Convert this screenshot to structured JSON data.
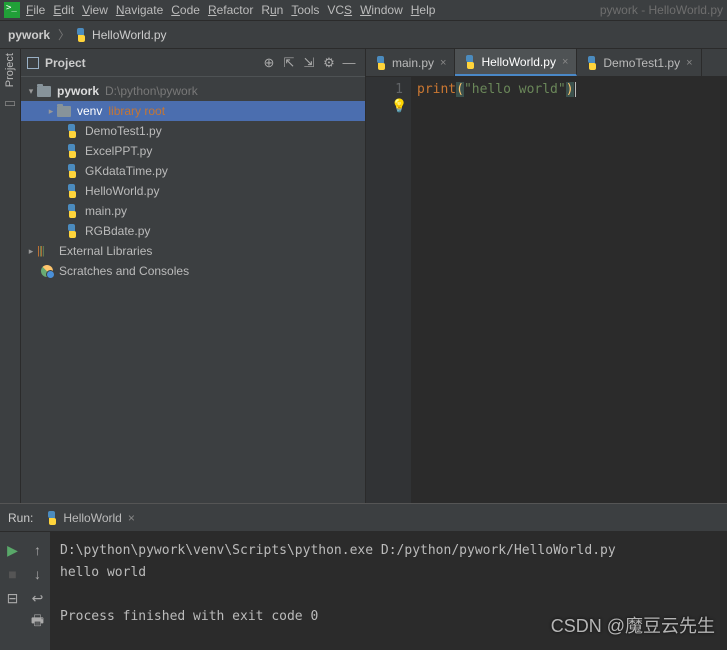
{
  "window_title": "pywork - HelloWorld.py",
  "menu": [
    "File",
    "Edit",
    "View",
    "Navigate",
    "Code",
    "Refactor",
    "Run",
    "Tools",
    "VCS",
    "Window",
    "Help"
  ],
  "breadcrumbs": {
    "project": "pywork",
    "file": "HelloWorld.py"
  },
  "project_panel": {
    "title": "Project",
    "root": {
      "name": "pywork",
      "path": "D:\\python\\pywork"
    },
    "venv": {
      "name": "venv",
      "hint": "library root"
    },
    "files": [
      "DemoTest1.py",
      "ExcelPPT.py",
      "GKdataTime.py",
      "HelloWorld.py",
      "main.py",
      "RGBdate.py"
    ],
    "external": "External Libraries",
    "scratches": "Scratches and Consoles"
  },
  "editor_tabs": [
    {
      "name": "main.py",
      "active": false
    },
    {
      "name": "HelloWorld.py",
      "active": true
    },
    {
      "name": "DemoTest1.py",
      "active": false
    }
  ],
  "code": {
    "line_no": "1",
    "kw": "print",
    "lp": "(",
    "str": "\"hello world\"",
    "rp": ")"
  },
  "run": {
    "label": "Run:",
    "config": "HelloWorld",
    "lines": [
      "D:\\python\\pywork\\venv\\Scripts\\python.exe D:/python/pywork/HelloWorld.py",
      "hello world",
      "",
      "Process finished with exit code 0"
    ]
  },
  "watermark": "CSDN @魔豆云先生"
}
